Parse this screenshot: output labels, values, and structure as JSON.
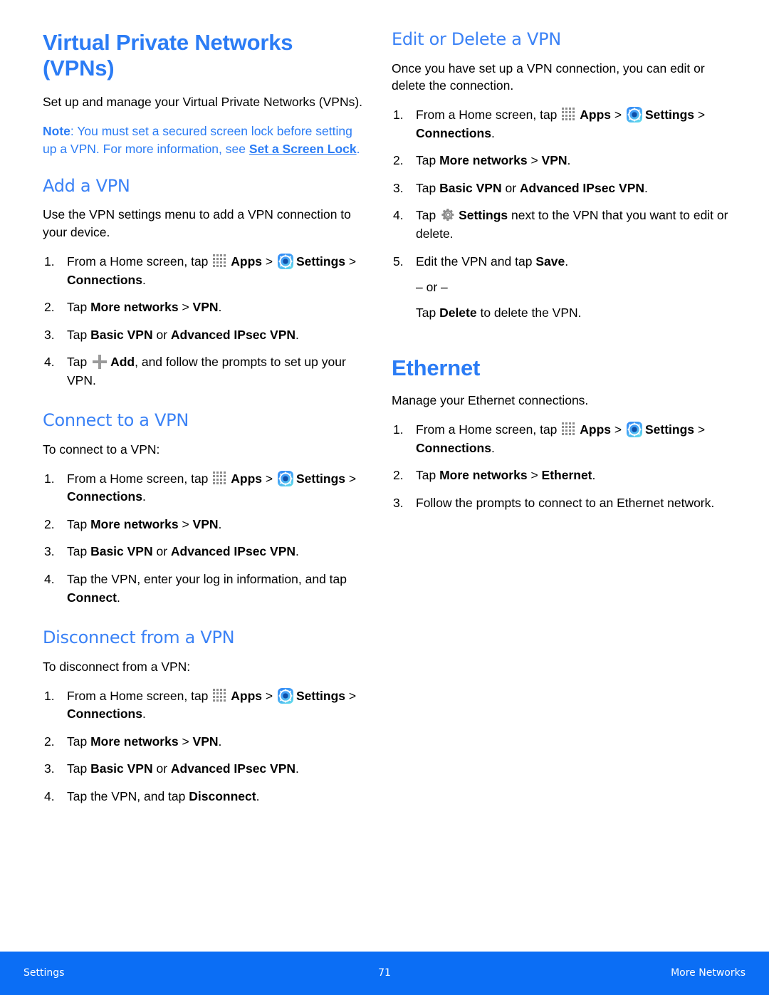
{
  "document": {
    "title": "Virtual Private Networks (VPNs)",
    "intro": "Set up and manage your Virtual Private Networks (VPNs).",
    "note": {
      "label": "Note",
      "separator": ": ",
      "text_before_link": "You must set a secured screen lock before setting up a VPN. For more information, see ",
      "link_text": "Set a Screen Lock",
      "text_after_link": "."
    }
  },
  "icons": {
    "apps": "apps-grid-icon",
    "settings": "settings-gear-icon",
    "plus": "plus-icon",
    "gear_gray": "gear-gray-icon"
  },
  "colors": {
    "heading_blue": "#2b7cf5",
    "subheading_blue": "#3b82f6",
    "footer_blue": "#0b6ef5",
    "body_black": "#000000",
    "icon_gray": "#8c8c8c"
  },
  "common": {
    "step_home": {
      "a": "From a Home screen, tap ",
      "apps": "Apps",
      "arrow1": " > ",
      "settings": "Settings",
      "b": " > ",
      "connections": "Connections",
      "period": "."
    },
    "step_more_networks_vpn": {
      "tap": "Tap ",
      "more_networks": "More networks",
      "arrow": " > ",
      "vpn": "VPN",
      "period": "."
    },
    "step_more_networks_ethernet": {
      "tap": "Tap ",
      "more_networks": "More networks",
      "arrow": " > ",
      "ethernet": "Ethernet",
      "period": "."
    },
    "step_basic_or_advanced": {
      "tap": "Tap ",
      "basic": "Basic VPN",
      "or": " or ",
      "advanced": "Advanced IPsec VPN",
      "period": "."
    }
  },
  "sections": {
    "add_vpn": {
      "heading": "Add a VPN",
      "intro": "Use the VPN settings menu to add a VPN connection to your device.",
      "step4": {
        "tap": "Tap ",
        "add": "Add",
        "rest": ", and follow the prompts to set up your VPN."
      }
    },
    "connect_vpn": {
      "heading": "Connect to a VPN",
      "intro": "To connect to a VPN:",
      "step4": {
        "text_before": "Tap the VPN, enter your log in information, and tap ",
        "bold": "Connect",
        "period": "."
      }
    },
    "disconnect_vpn": {
      "heading": "Disconnect from a VPN",
      "intro": "To disconnect from a VPN:",
      "step4": {
        "text_before": "Tap the VPN, and tap ",
        "bold": "Disconnect",
        "period": "."
      }
    },
    "edit_delete_vpn": {
      "heading": "Edit or Delete a VPN",
      "intro": "Once you have set up a VPN connection, you can edit or delete the connection.",
      "step4": {
        "tap": "Tap ",
        "settings": "Settings",
        "rest": " next to the VPN that you want to edit or delete."
      },
      "step5": {
        "text_before": "Edit the VPN and tap ",
        "bold": "Save",
        "period": "."
      },
      "or_line": "– or –",
      "delete_line": {
        "text_before": "Tap ",
        "bold": "Delete",
        "text_after": " to delete the VPN."
      }
    },
    "ethernet": {
      "heading": "Ethernet",
      "intro": "Manage your Ethernet connections.",
      "step3": "Follow the prompts to connect to an Ethernet network."
    }
  },
  "footer": {
    "left": "Settings",
    "page_number": "71",
    "right": "More Networks"
  }
}
